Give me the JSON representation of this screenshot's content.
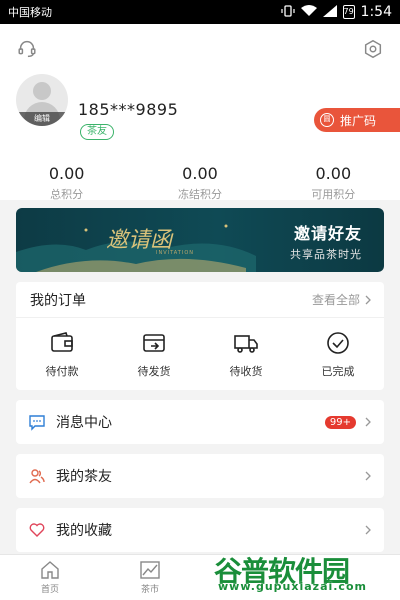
{
  "status_bar": {
    "carrier": "中国移动",
    "battery": "79",
    "time": "1:54"
  },
  "header": {
    "support_icon": "headset-icon",
    "settings_icon": "hexagon-settings-icon"
  },
  "profile": {
    "avatar_edit_label": "编辑",
    "phone": "185***9895",
    "tag": "茶友",
    "promo_icon": "圆",
    "promo_label": "推广码"
  },
  "stats": [
    {
      "value": "0.00",
      "label": "总积分"
    },
    {
      "value": "0.00",
      "label": "冻结积分"
    },
    {
      "value": "0.00",
      "label": "可用积分"
    }
  ],
  "banner": {
    "calligraphy": "邀请函",
    "calligraphy_sub": "INVITATION",
    "title": "邀请好友",
    "subtitle": "共享品茶时光"
  },
  "orders": {
    "title": "我的订单",
    "view_all": "查看全部",
    "items": [
      {
        "label": "待付款",
        "icon": "wallet-icon"
      },
      {
        "label": "待发货",
        "icon": "card-send-icon"
      },
      {
        "label": "待收货",
        "icon": "truck-icon"
      },
      {
        "label": "已完成",
        "icon": "check-circle-icon"
      }
    ]
  },
  "menu": [
    {
      "label": "消息中心",
      "icon": "message-icon",
      "badge": "99+",
      "color": "#2f7fd6"
    },
    {
      "label": "我的茶友",
      "icon": "friends-icon",
      "badge": "",
      "color": "#e06a4f"
    },
    {
      "label": "我的收藏",
      "icon": "heart-icon",
      "badge": "",
      "color": "#e0455a"
    }
  ],
  "bottom_nav": [
    {
      "label": "首页",
      "icon": "home-icon"
    },
    {
      "label": "茶市",
      "icon": "chart-icon"
    }
  ],
  "watermark": {
    "main": "谷普软件园",
    "sub": "www.gupuxiazai.com"
  },
  "colors": {
    "accent_red": "#e9553b",
    "tag_green": "#3bb36a",
    "banner_bg": "#0f4a55"
  }
}
